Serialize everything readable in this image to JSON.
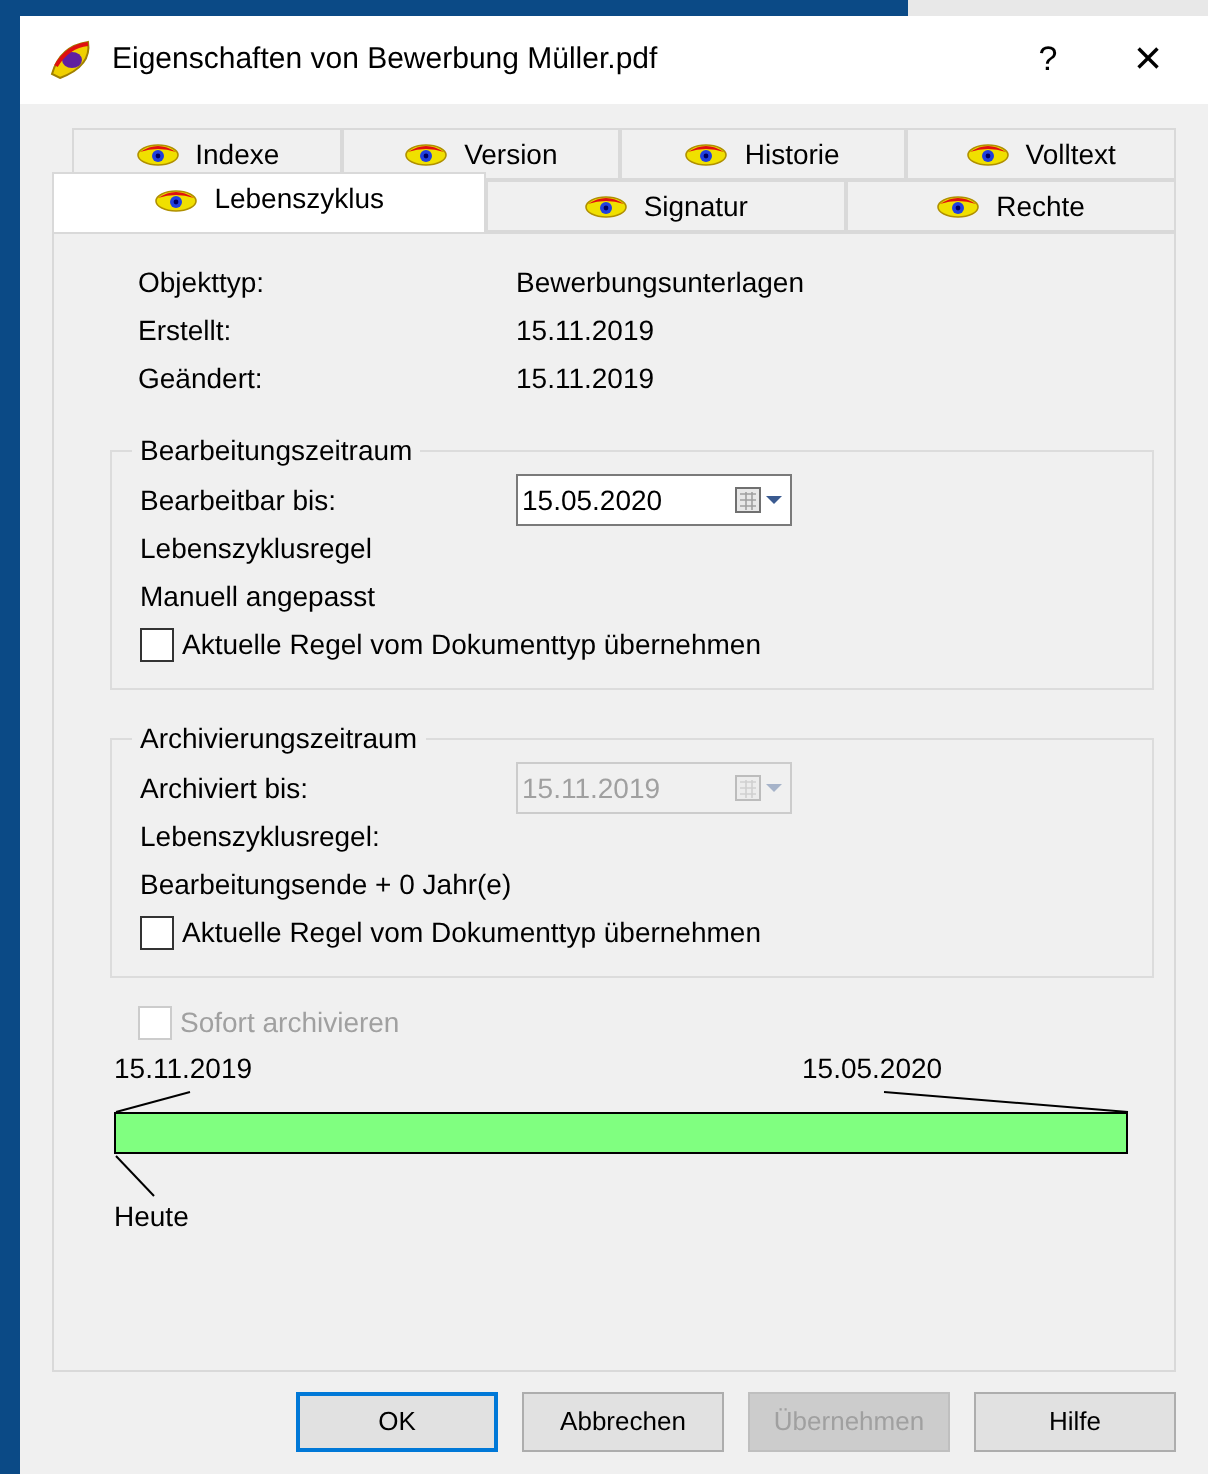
{
  "window": {
    "title": "Eigenschaften von Bewerbung Müller.pdf",
    "help": "?",
    "close": "×"
  },
  "tab_rows": [
    [
      {
        "label": "Indexe",
        "selected": false
      },
      {
        "label": "Version",
        "selected": false
      },
      {
        "label": "Historie",
        "selected": false
      },
      {
        "label": "Volltext",
        "selected": false
      }
    ],
    [
      {
        "label": "Lebenszyklus",
        "selected": true
      },
      {
        "label": "Signatur",
        "selected": false
      },
      {
        "label": "Rechte",
        "selected": false
      }
    ]
  ],
  "info": [
    {
      "label": "Objekttyp:",
      "value": "Bewerbungsunterlagen"
    },
    {
      "label": "Erstellt:",
      "value": "15.11.2019"
    },
    {
      "label": "Geändert:",
      "value": "15.11.2019"
    }
  ],
  "groups": [
    {
      "title": "Bearbeitungszeitraum",
      "date_label": "Bearbeitbar bis:",
      "date": "15.05.2020",
      "disabled": false,
      "rule_label": "Lebenszyklusregel",
      "rule": "Manuell angepasst",
      "checkbox": {
        "label": "Aktuelle Regel vom Dokumenttyp übernehmen",
        "checked": false,
        "disabled": false
      }
    },
    {
      "title": "Archivierungszeitraum",
      "date_label": "Archiviert bis:",
      "date": "15.11.2019",
      "disabled": true,
      "rule_label": "Lebenszyklusregel:",
      "rule": "Bearbeitungsende + 0 Jahr(e)",
      "checkbox": {
        "label": "Aktuelle Regel vom Dokumenttyp übernehmen",
        "checked": false,
        "disabled": false
      }
    }
  ],
  "archive_now": {
    "label": "Sofort archivieren",
    "checked": false,
    "disabled": true
  },
  "timeline": {
    "start": "15.11.2019",
    "end": "15.05.2020",
    "today": "Heute",
    "color": "#80ff80"
  },
  "buttons": [
    {
      "label": "OK",
      "default": true,
      "disabled": false
    },
    {
      "label": "Abbrechen",
      "default": false,
      "disabled": false
    },
    {
      "label": "Übernehmen",
      "default": false,
      "disabled": true
    },
    {
      "label": "Hilfe",
      "default": false,
      "disabled": false
    }
  ]
}
